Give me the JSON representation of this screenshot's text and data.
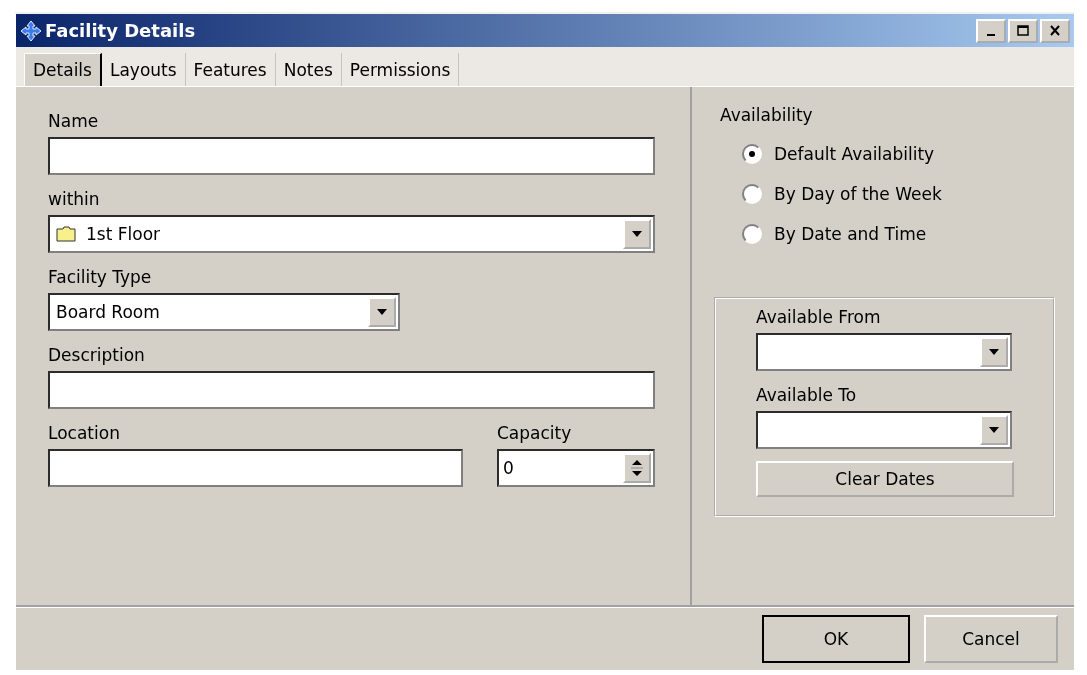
{
  "window": {
    "title": "Facility Details"
  },
  "tabs": [
    {
      "label": "Details",
      "selected": true
    },
    {
      "label": "Layouts",
      "selected": false
    },
    {
      "label": "Features",
      "selected": false
    },
    {
      "label": "Notes",
      "selected": false
    },
    {
      "label": "Permissions",
      "selected": false
    }
  ],
  "details": {
    "name": {
      "label": "Name"
    },
    "within": {
      "label": "within",
      "value": "1st Floor"
    },
    "facility_type": {
      "label": "Facility Type",
      "value": "Board Room"
    },
    "description": {
      "label": "Description"
    },
    "location": {
      "label": "Location"
    },
    "capacity": {
      "label": "Capacity",
      "value": "0"
    }
  },
  "availability": {
    "label": "Availability",
    "options": [
      {
        "label": "Default Availability",
        "selected": true
      },
      {
        "label": "By Day of the Week",
        "selected": false
      },
      {
        "label": "By Date and Time",
        "selected": false
      }
    ],
    "available_from": {
      "label": "Available From"
    },
    "available_to": {
      "label": "Available To"
    },
    "clear_button": "Clear Dates"
  },
  "buttons": [
    {
      "label": "OK",
      "default": true
    },
    {
      "label": "Cancel",
      "default": false
    }
  ]
}
